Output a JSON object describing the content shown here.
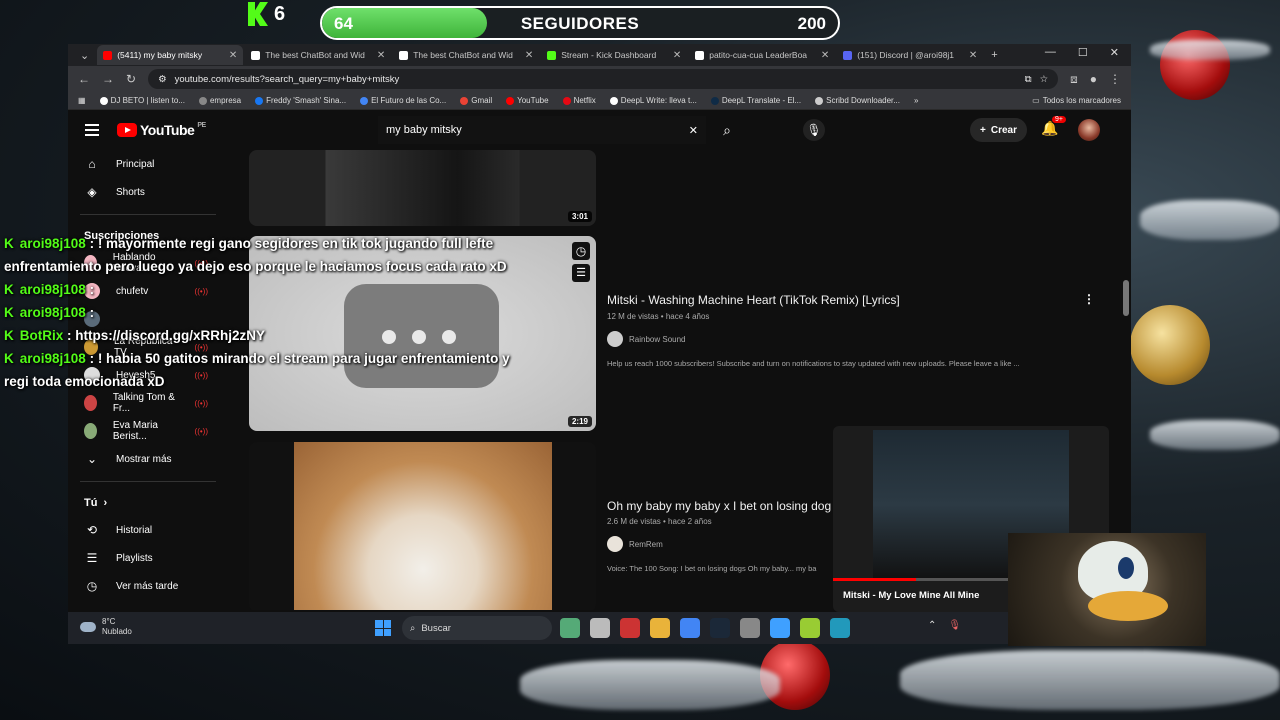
{
  "overlay": {
    "kick_count": "6",
    "follow_current": "64",
    "follow_label": "SEGUIDORES",
    "follow_goal": "200",
    "follow_progress": 0.32
  },
  "browser": {
    "tabs": [
      {
        "title": "(5411) my baby mitsky",
        "active": true,
        "color": "#ff0000"
      },
      {
        "title": "The best ChatBot and Wid",
        "active": false,
        "color": "#ffffff"
      },
      {
        "title": "The best ChatBot and Wid",
        "active": false,
        "color": "#ffffff"
      },
      {
        "title": "Stream - Kick Dashboard",
        "active": false,
        "color": "#53fc18"
      },
      {
        "title": "patito-cua-cua LeaderBoa",
        "active": false,
        "color": "#ffffff"
      },
      {
        "title": "(151) Discord | @aroi98j1",
        "active": false,
        "color": "#5865f2"
      }
    ],
    "url": "youtube.com/results?search_query=my+baby+mitsky",
    "bookmarks": [
      {
        "label": "DJ BETO | listen to...",
        "color": "#ffffff"
      },
      {
        "label": "empresa",
        "color": "#888888"
      },
      {
        "label": "Freddy 'Smash' Sina...",
        "color": "#1877f2"
      },
      {
        "label": "El Futuro de las Co...",
        "color": "#4285f4"
      },
      {
        "label": "Gmail",
        "color": "#ea4335"
      },
      {
        "label": "YouTube",
        "color": "#ff0000"
      },
      {
        "label": "Netflix",
        "color": "#e50914"
      },
      {
        "label": "DeepL Write: lleva t...",
        "color": "#ffffff"
      },
      {
        "label": "DeepL Translate - El...",
        "color": "#0f2b46"
      },
      {
        "label": "Scribd Downloader...",
        "color": "#cccccc"
      }
    ],
    "bookmarks_more": "»",
    "all_bookmarks": "Todos los marcadores"
  },
  "youtube": {
    "logo": "YouTube",
    "region": "PE",
    "search_value": "my baby mitsky",
    "create_label": "Crear",
    "notif_count": "9+",
    "sidebar": {
      "main": [
        {
          "label": "Principal",
          "icon": "home-icon",
          "glyph": "⌂"
        },
        {
          "label": "Shorts",
          "icon": "shorts-icon",
          "glyph": "◈"
        }
      ],
      "subscriptions_title": "Suscripciones",
      "subscriptions": [
        {
          "label": "Hablando Hueva...",
          "color": "#f4b6c2",
          "live": true
        },
        {
          "label": "chufetv",
          "color": "#f4b6c2",
          "live": true
        },
        {
          "label": "",
          "color": "#5a6b7a",
          "live": false
        },
        {
          "label": "La Republica TV",
          "color": "#c93",
          "live": true
        },
        {
          "label": "Hevesh5",
          "color": "#ddd",
          "live": true
        },
        {
          "label": "Talking Tom & Fr...",
          "color": "#c44",
          "live": true
        },
        {
          "label": "Eva Maria Berist...",
          "color": "#8a7",
          "live": true
        }
      ],
      "more": "Mostrar más",
      "you_title": "Tú",
      "you_items": [
        {
          "label": "Historial",
          "icon": "history-icon",
          "glyph": "⟲"
        },
        {
          "label": "Playlists",
          "icon": "playlists-icon",
          "glyph": "☰"
        },
        {
          "label": "Ver más tarde",
          "icon": "watch-later-icon",
          "glyph": "◷"
        }
      ]
    },
    "results": [
      {
        "duration": "3:01"
      },
      {
        "title": "Mitski - Washing Machine Heart (TikTok Remix) [Lyrics]",
        "meta": "12 M de vistas • hace 4 años",
        "channel": "Rainbow Sound",
        "description": "Help us reach 1000 subscribers! Subscribe and turn on notifications to stay updated with new uploads. Please leave a like ...",
        "duration": "2:19"
      },
      {
        "title": "Oh my baby my baby x I bet on losing dog",
        "meta": "2.6 M de vistas • hace 2 años",
        "channel": "RemRem",
        "description": "Voice: The 100 Song: I bet on losing dogs Oh my baby... my ba"
      }
    ],
    "miniplayer": {
      "title": "Mitski - My Love Mine All Mine",
      "progress": 0.3
    }
  },
  "taskbar": {
    "temperature": "8°C",
    "weather": "Nublado",
    "search_label": "Buscar",
    "apps": [
      "#5a7",
      "#bbb",
      "#c33",
      "#e9b33a",
      "#4285f4",
      "#1b2838",
      "#888",
      "#3fa0ff",
      "#9c3",
      "#29b"
    ]
  },
  "chat": [
    {
      "user": "aroi98j108",
      "message": "! mayormente regi gano segidores en tik tok jugando full lefte enfrentamiento pero luego ya dejo eso porque le haciamos focus cada rato xD"
    },
    {
      "user": "aroi98j108",
      "message": ""
    },
    {
      "user": "aroi98j108",
      "message": ""
    },
    {
      "user": "BotRix",
      "message": "https://discord.gg/xRRhj2zNY",
      "bot": true
    },
    {
      "user": "aroi98j108",
      "message": "! habia 50 gatitos mirando el stream para jugar enfrentamiento y regi toda emocionada xD"
    }
  ]
}
